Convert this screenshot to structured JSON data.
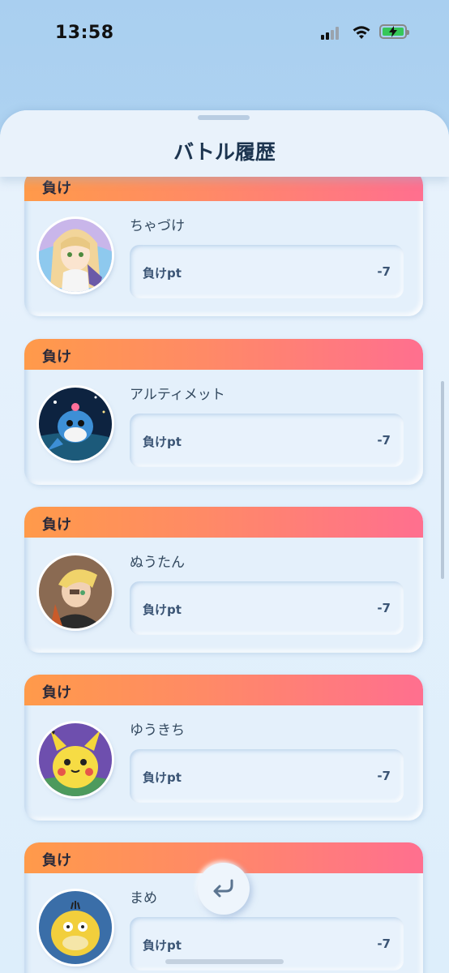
{
  "status": {
    "time": "13:58",
    "battery_color": "#36c759"
  },
  "header": {
    "title": "バトル履歴"
  },
  "battles": [
    {
      "result": "負け",
      "player": "ちゃづけ",
      "pt_label": "負けpt",
      "pt_value": "-7",
      "avatar": "girl-character-avatar"
    },
    {
      "result": "負け",
      "player": "アルティメット",
      "pt_label": "負けpt",
      "pt_value": "-7",
      "avatar": "sea-lion-pokemon-avatar"
    },
    {
      "result": "負け",
      "player": "ぬうたん",
      "pt_label": "負けpt",
      "pt_value": "-7",
      "avatar": "blond-boy-character-avatar"
    },
    {
      "result": "負け",
      "player": "ゆうきち",
      "pt_label": "負けpt",
      "pt_value": "-7",
      "avatar": "pikachu-avatar"
    },
    {
      "result": "負け",
      "player": "まめ",
      "pt_label": "負けpt",
      "pt_value": "-7",
      "avatar": "psyduck-avatar"
    }
  ],
  "colors": {
    "loss_gradient_start": "#ff9a4a",
    "loss_gradient_end": "#ff6f8f",
    "title_color": "#1d3550"
  },
  "back_button_icon": "return-arrow-icon"
}
